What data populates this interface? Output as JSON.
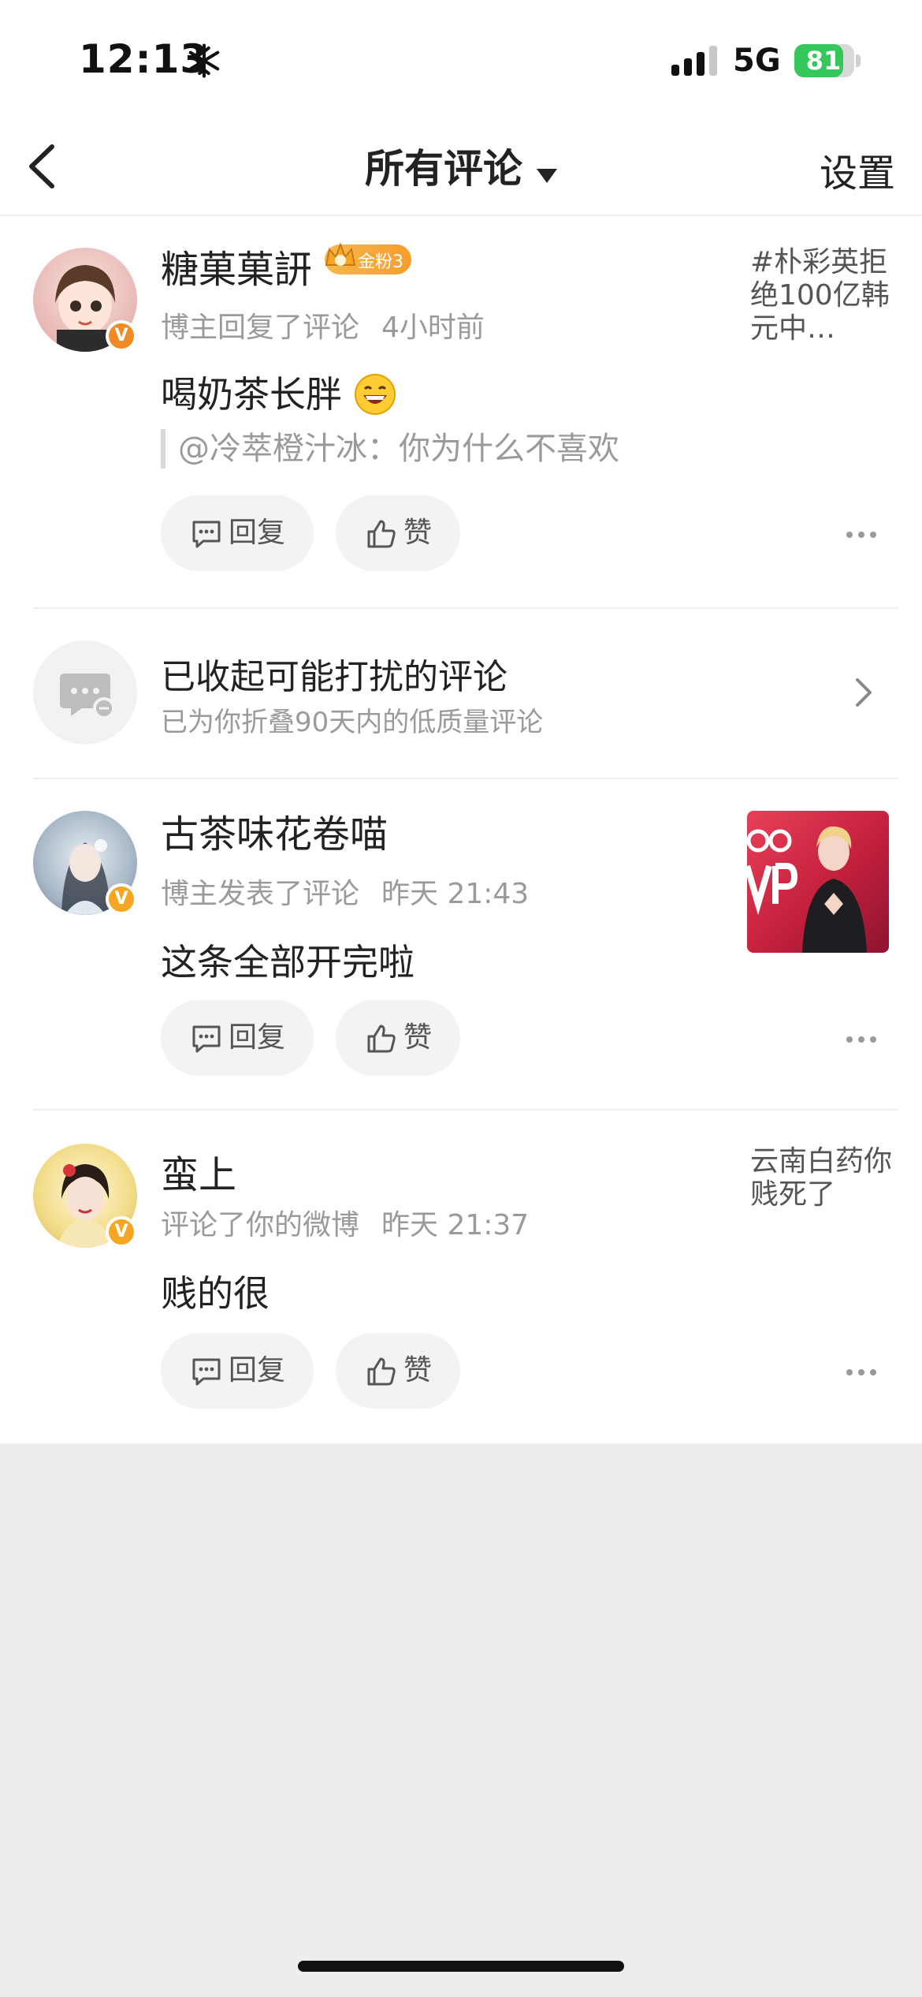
{
  "status_bar": {
    "time": "12:13",
    "network": "5G",
    "battery": "81",
    "battery_level": 0.81
  },
  "nav": {
    "title": "所有评论",
    "settings": "设置"
  },
  "comments": [
    {
      "name": "糖菓菓訮",
      "fan_badge": "金粉3",
      "meta_action": "博主回复了评论",
      "meta_time": "4小时前",
      "content": "喝奶茶长胖",
      "quote": "@冷萃橙汁冰：你为什么不喜欢",
      "side_text": "#朴彩英拒绝100亿韩元中…",
      "reply_label": "回复",
      "like_label": "赞"
    },
    {
      "name": "古茶味花卷喵",
      "meta_action": "博主发表了评论",
      "meta_time": "昨天 21:43",
      "content": "这条全部开完啦",
      "reply_label": "回复",
      "like_label": "赞"
    },
    {
      "name": "蛮上",
      "meta_action": "评论了你的微博",
      "meta_time": "昨天 21:37",
      "content": "贱的很",
      "side_text": "云南白药你贱死了",
      "reply_label": "回复",
      "like_label": "赞"
    }
  ],
  "folded": {
    "title": "已收起可能打扰的评论",
    "subtitle": "已为你折叠90天内的低质量评论"
  },
  "colors": {
    "accent_orange": "#f5a623",
    "badge_orange": "#f08a24",
    "battery_green": "#34c759",
    "text_gray": "#9a9a9a"
  }
}
